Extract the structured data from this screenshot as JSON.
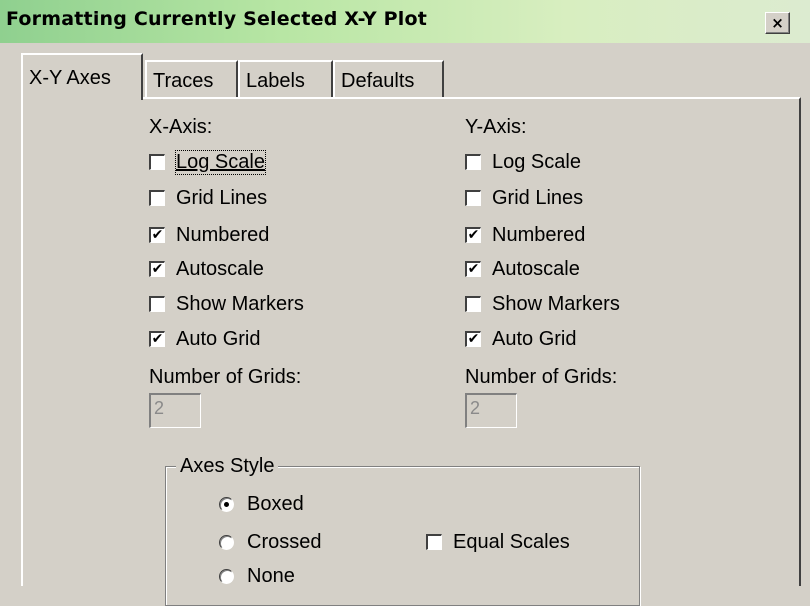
{
  "window": {
    "title": "Formatting Currently Selected X-Y Plot",
    "close_label": "×"
  },
  "tabs": [
    {
      "label": "X-Y Axes",
      "active": true
    },
    {
      "label": "Traces",
      "active": false
    },
    {
      "label": "Labels",
      "active": false
    },
    {
      "label": "Defaults",
      "active": false
    }
  ],
  "x_axis": {
    "heading": "X-Axis:",
    "log_scale": {
      "label": "Log Scale",
      "checked": false
    },
    "grid_lines": {
      "label": "Grid Lines",
      "checked": false
    },
    "numbered": {
      "label": "Numbered",
      "checked": true
    },
    "autoscale": {
      "label": "Autoscale",
      "checked": true
    },
    "show_markers": {
      "label": "Show Markers",
      "checked": false
    },
    "auto_grid": {
      "label": "Auto Grid",
      "checked": true
    },
    "grids_label": "Number of Grids:",
    "grids_value": "2"
  },
  "y_axis": {
    "heading": "Y-Axis:",
    "log_scale": {
      "label": "Log Scale",
      "checked": false
    },
    "grid_lines": {
      "label": "Grid Lines",
      "checked": false
    },
    "numbered": {
      "label": "Numbered",
      "checked": true
    },
    "autoscale": {
      "label": "Autoscale",
      "checked": true
    },
    "show_markers": {
      "label": "Show Markers",
      "checked": false
    },
    "auto_grid": {
      "label": "Auto Grid",
      "checked": true
    },
    "grids_label": "Number of Grids:",
    "grids_value": "2"
  },
  "axes_style": {
    "title": "Axes Style",
    "options": [
      {
        "label": "Boxed",
        "selected": true
      },
      {
        "label": "Crossed",
        "selected": false
      },
      {
        "label": "None",
        "selected": false
      }
    ],
    "equal_scales": {
      "label": "Equal Scales",
      "checked": false
    }
  },
  "check_mark": "✔"
}
